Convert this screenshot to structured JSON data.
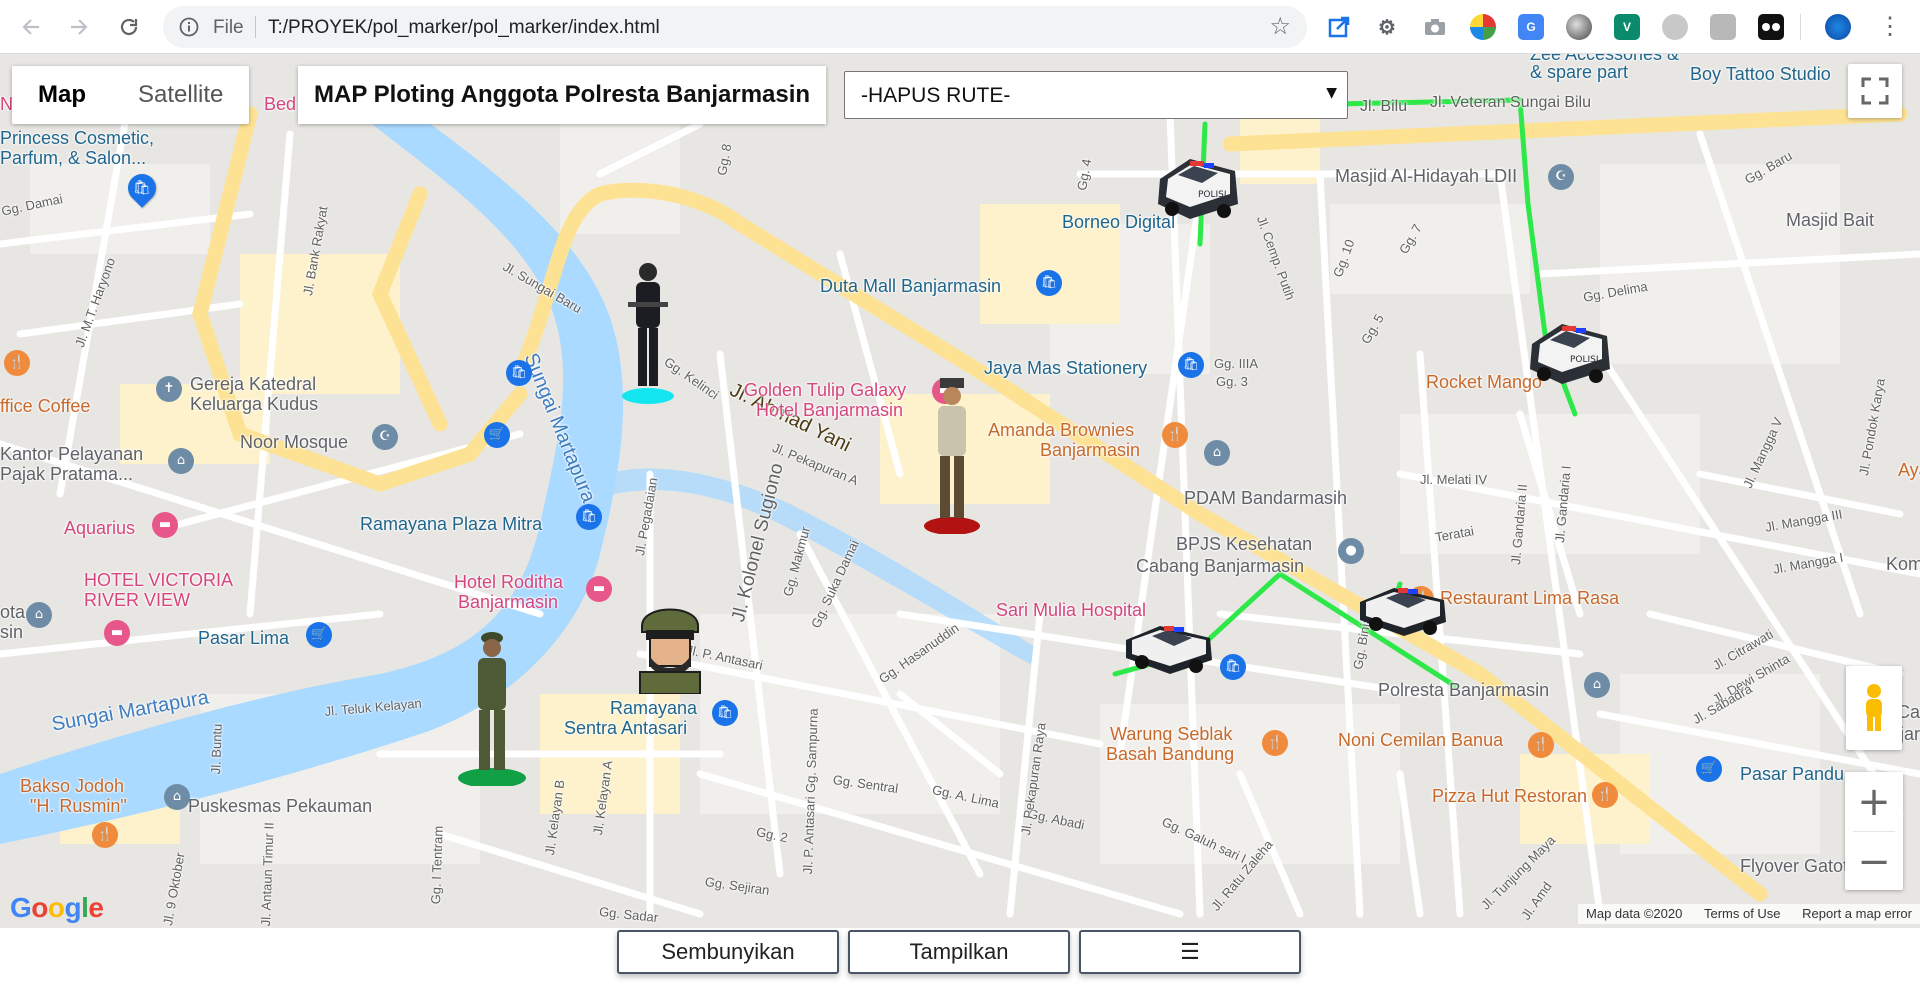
{
  "browser": {
    "back_icon": "arrow-left-icon",
    "forward_icon": "arrow-right-icon",
    "reload_icon": "reload-icon",
    "scheme_label": "File",
    "url": "T:/PROYEK/pol_marker/pol_marker/index.html",
    "star_icon": "star-icon",
    "menu_icon": "kebab-menu-icon"
  },
  "map_controls": {
    "map_type_map": "Map",
    "map_type_satellite": "Satellite",
    "title": "MAP Ploting Anggota Polresta Banjarmasin",
    "route_select_value": "-HAPUS RUTE-",
    "zoom_in": "+",
    "zoom_out": "−",
    "fullscreen_icon": "fullscreen-icon",
    "pegman_icon": "street-view-pegman-icon"
  },
  "map_labels": {
    "accessories": "Zee Accessories &",
    "spare_part": "& spare part",
    "boy_tattoo": "Boy Tattoo Studio",
    "veteran": "Jl. Veteran Sungai Bilu",
    "bilu": "Jl. Bilu",
    "princess1": "Princess Cosmetic,",
    "princess2": "Parfum, & Salon...",
    "masjid_hidayah": "Masjid Al-Hidayah LDII",
    "masjid_bait": "Masjid Bait",
    "borneo": "Borneo Digital",
    "duta_mall": "Duta Mall Banjarmasin",
    "ahmad_yani": "Jl. Ahmad Yani",
    "sungai_martapura_v": "Sungai Martapura",
    "sungai_martapura_h": "Sungai Martapura",
    "gereja1": "Gereja Katedral",
    "gereja2": "Keluarga Kudus",
    "coffee": "ffice Coffee",
    "noor": "Noor Mosque",
    "kantor1": "Kantor Pelayanan",
    "kantor2": "Pajak Pratama...",
    "golden1": "Golden Tulip Galaxy",
    "golden2": "Hotel Banjarmasin",
    "jaya_mas": "Jaya Mas Stationery",
    "rocket": "Rocket Mango",
    "amanda1": "Amanda Brownies",
    "amanda2": "Banjarmasin",
    "aquarius": "Aquarius",
    "pdam": "PDAM Bandarmasih",
    "ramayana_plaza": "Ramayana Plaza Mitra",
    "bpjs1": "BPJS Kesehatan",
    "bpjs2": "Cabang Banjarmasin",
    "hotel_victoria1": "HOTEL VICTORIA",
    "hotel_victoria2": "RIVER VIEW",
    "hotel_roditha1": "Hotel Roditha",
    "hotel_roditha2": "Banjarmasin",
    "sari_mulia": "Sari Mulia Hospital",
    "restaurant": "Restaurant Lima Rasa",
    "pasar_lima": "Pasar Lima",
    "polresta": "Polresta Banjarmasin",
    "ramayana_sentra1": "Ramayana",
    "ramayana_sentra2": "Sentra Antasari",
    "warung1": "Warung Seblak",
    "warung2": "Basah Bandung",
    "noni": "Noni Cemilan Banua",
    "jne1": "JNE Ca",
    "jne2": "Banjarm",
    "pasar_pandu": "Pasar Pandu",
    "bakso1": "Bakso Jodoh",
    "bakso2": "\"H. Rusmin\"",
    "puskesmas": "Puskesmas Pekauman",
    "pizza": "Pizza Hut Restoran",
    "flyover": "Flyover Gatot",
    "ayan": "Ayan",
    "kom": "Kom",
    "ota": "ota",
    "sin": "sin",
    "ne": "Ne",
    "bed": "Bed"
  },
  "road_labels": {
    "gg8": "Gg. 8",
    "gg_damai": "Gg. Damai",
    "haryono": "Jl. M.T. Haryono",
    "bank_rakyat": "Jl. Bank Rakyat",
    "sungai_baru": "Jl. Sungai Baru",
    "kelinci": "Gg. Kelinci",
    "pekapuran_a": "Jl. Pekapuran A",
    "kolonel_sugiono": "Jl. Kolonel Sugiono",
    "pegadaian": "Jl. Pegadaian",
    "makmur": "Gg. Makmur",
    "suka_damai": "Gg. Suka Damai",
    "hasanuddin": "Gg. Hasanuddin",
    "p_antasari": "Jl. P. Antasari",
    "teluk_kelayan": "Jl. Teluk Kelayan",
    "sentral": "Gg. Sentral",
    "a_lima": "Gg. A. Lima",
    "abadi": "Gg. Abadi",
    "sejiran": "Gg. Sejiran",
    "sadar": "Gg. Sadar",
    "gg2": "Gg. 2",
    "gg3": "Gg. 3",
    "gg4": "Gg. 4",
    "gg5": "Gg. 5",
    "gg7": "Gg. 7",
    "gg10": "Gg. 10",
    "gg_baru": "Gg. Baru",
    "gg_delima": "Gg. Delima",
    "gg_iiia": "Gg. IIIA",
    "cemp_putih": "Jl. Cemp. Putih",
    "teratai": "Teratai",
    "melati_iv": "Jl. Melati IV",
    "gandaria_ii": "Jl. Gandaria II",
    "gandaria_i": "Jl. Gandaria I",
    "mangga_iii": "Jl. Mangga III",
    "mangga_i": "Jl. Mangga I",
    "citrawati": "Jl. Citrawati",
    "dewi_shinta": "Jl. Dewi Shinta",
    "sabadra": "Jl. Sabadra",
    "binjai": "Gg. Binjai",
    "galuh_sari": "Gg. Galuh sari I",
    "ratu_zaleha": "Jl. Ratu Zaleha",
    "tunjung_maya": "Jl. Tunjung Maya",
    "pekapuran_raya": "Jl. Pekapuran Raya",
    "kelayan_a": "Jl. Kelayan A",
    "kelayan_b": "Jl. Kelayan B",
    "tenram": "Gg. I Tentram",
    "oktober": "Jl. 9 Oktober",
    "buntu": "Jl. Buntu",
    "timur": "Jl. Antaun Timur II",
    "sampurna": "Jl. P. Antasari Gg. Sampurna",
    "pondok_karya": "Jl. Pondok Karya",
    "mangga_v": "Jl. Mangga V",
    "amd": "Jl. Amd"
  },
  "markers": {
    "police_cars": [
      "police-car-marker",
      "police-car-marker",
      "police-car-marker",
      "police-car-marker"
    ],
    "personnel": [
      "brimob-officer-marker",
      "police-officer-marker",
      "army-soldier-marker",
      "soldier-avatar-marker"
    ]
  },
  "attribution": {
    "google": "Google",
    "map_data": "Map data ©2020",
    "terms": "Terms of Use",
    "report": "Report a map error"
  },
  "bottom_bar": {
    "hide_button": "Sembunyikan",
    "show_button": "Tampilkan",
    "menu_button": "☰"
  },
  "colors": {
    "route_green": "#2ee84a",
    "major_road": "#fde293",
    "water": "#aadaff",
    "map_bg": "#e8e6e3"
  }
}
